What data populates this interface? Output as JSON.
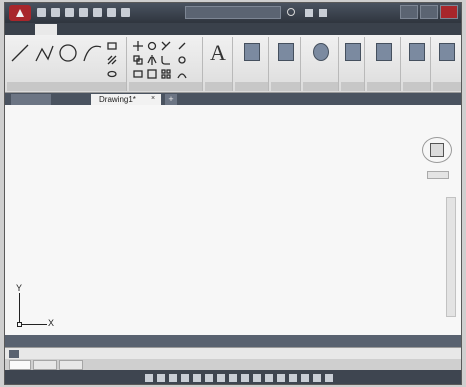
{
  "title_bar": {
    "title": "",
    "search": {
      "placeholder": ""
    },
    "icons": [
      "quick-access-icons",
      "search-icon",
      "window-controls"
    ]
  },
  "ribbon": {
    "tabs": [
      {
        "label": ""
      },
      {
        "label": ""
      },
      {
        "label": ""
      },
      {
        "label": ""
      },
      {
        "label": ""
      },
      {
        "label": ""
      },
      {
        "label": ""
      },
      {
        "label": ""
      },
      {
        "label": ""
      },
      {
        "label": ""
      }
    ],
    "annotation_glyph": "A",
    "panels": [
      {
        "title": ""
      },
      {
        "title": ""
      },
      {
        "title": ""
      },
      {
        "title": ""
      },
      {
        "title": ""
      },
      {
        "title": ""
      },
      {
        "title": ""
      },
      {
        "title": ""
      },
      {
        "title": ""
      },
      {
        "title": ""
      },
      {
        "title": ""
      }
    ]
  },
  "file_tabs": {
    "start": "",
    "drawing": "Drawing1*",
    "add": "+"
  },
  "canvas": {
    "viewport_label": "",
    "background": "#f7f7f7",
    "ucs": {
      "x": "X",
      "y": "Y"
    },
    "navcube": {
      "face": "",
      "wcs": ""
    }
  },
  "command": {
    "history": "",
    "prompt": ""
  },
  "layout_tabs": [
    {
      "label": ""
    },
    {
      "label": ""
    },
    {
      "label": ""
    }
  ],
  "colors": {
    "title_bar": "#2f353e",
    "app_button": "#a8262b",
    "ribbon": "#e9e9e9",
    "command_bar": "#596270",
    "status_bar": "#3e4550"
  }
}
